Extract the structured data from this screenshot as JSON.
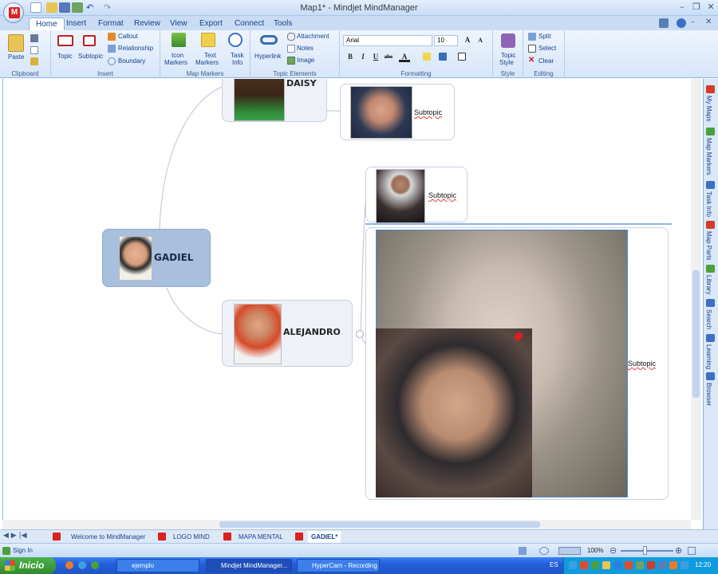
{
  "window": {
    "title": "Map1* - Mindjet MindManager",
    "logo_text": "M"
  },
  "tabs": [
    "Home",
    "Insert",
    "Format",
    "Review",
    "View",
    "Export",
    "Connect",
    "Tools"
  ],
  "ribbon": {
    "clipboard": {
      "label": "Clipboard",
      "paste": "Paste"
    },
    "insert": {
      "label": "Insert",
      "topic": "Topic",
      "subtopic": "Subtopic",
      "callout": "Callout",
      "relationship": "Relationship",
      "boundary": "Boundary"
    },
    "markers": {
      "label": "Map Markers",
      "icon_markers": "Icon",
      "icon_markers2": "Markers",
      "text_markers": "Text",
      "text_markers2": "Markers",
      "task_info": "Task",
      "task_info2": "Info"
    },
    "topic_elements": {
      "label": "Topic Elements",
      "hyperlink": "Hyperlink",
      "attachment": "Attachment",
      "notes": "Notes",
      "image": "Image"
    },
    "formatting": {
      "label": "Formatting",
      "font": "Arial",
      "size": "10",
      "bold": "B",
      "italic": "I",
      "underline": "U",
      "strike": "abc",
      "font_color": "A"
    },
    "style": {
      "label": "Style",
      "topic_style": "Topic",
      "topic_style2": "Style"
    },
    "editing": {
      "label": "Editing",
      "split": "Split",
      "select": "Select",
      "clear": "Clear"
    }
  },
  "map": {
    "central": "GADIEL",
    "topics": [
      {
        "label": "DAISY"
      },
      {
        "label": "ALEJANDRO"
      }
    ],
    "subtopics": [
      "Subtopic",
      "Subtopic",
      "Subtopic"
    ]
  },
  "side_panel": [
    "My Maps",
    "Map Markers",
    "Task Info",
    "Map Parts",
    "Library",
    "Search",
    "Learning",
    "Browser"
  ],
  "sheet_tabs": [
    "Welcome to MindManager",
    "LOGO MIND",
    "MAPA MENTAL",
    "GADIEL*"
  ],
  "status": {
    "sign_in": "Sign In",
    "zoom": "100%"
  },
  "taskbar": {
    "start": "Inicio",
    "items": [
      "ejemplo",
      "Mindjet MindManager...",
      "HyperCam - Recording"
    ],
    "lang": "ES",
    "clock": "12:20"
  }
}
